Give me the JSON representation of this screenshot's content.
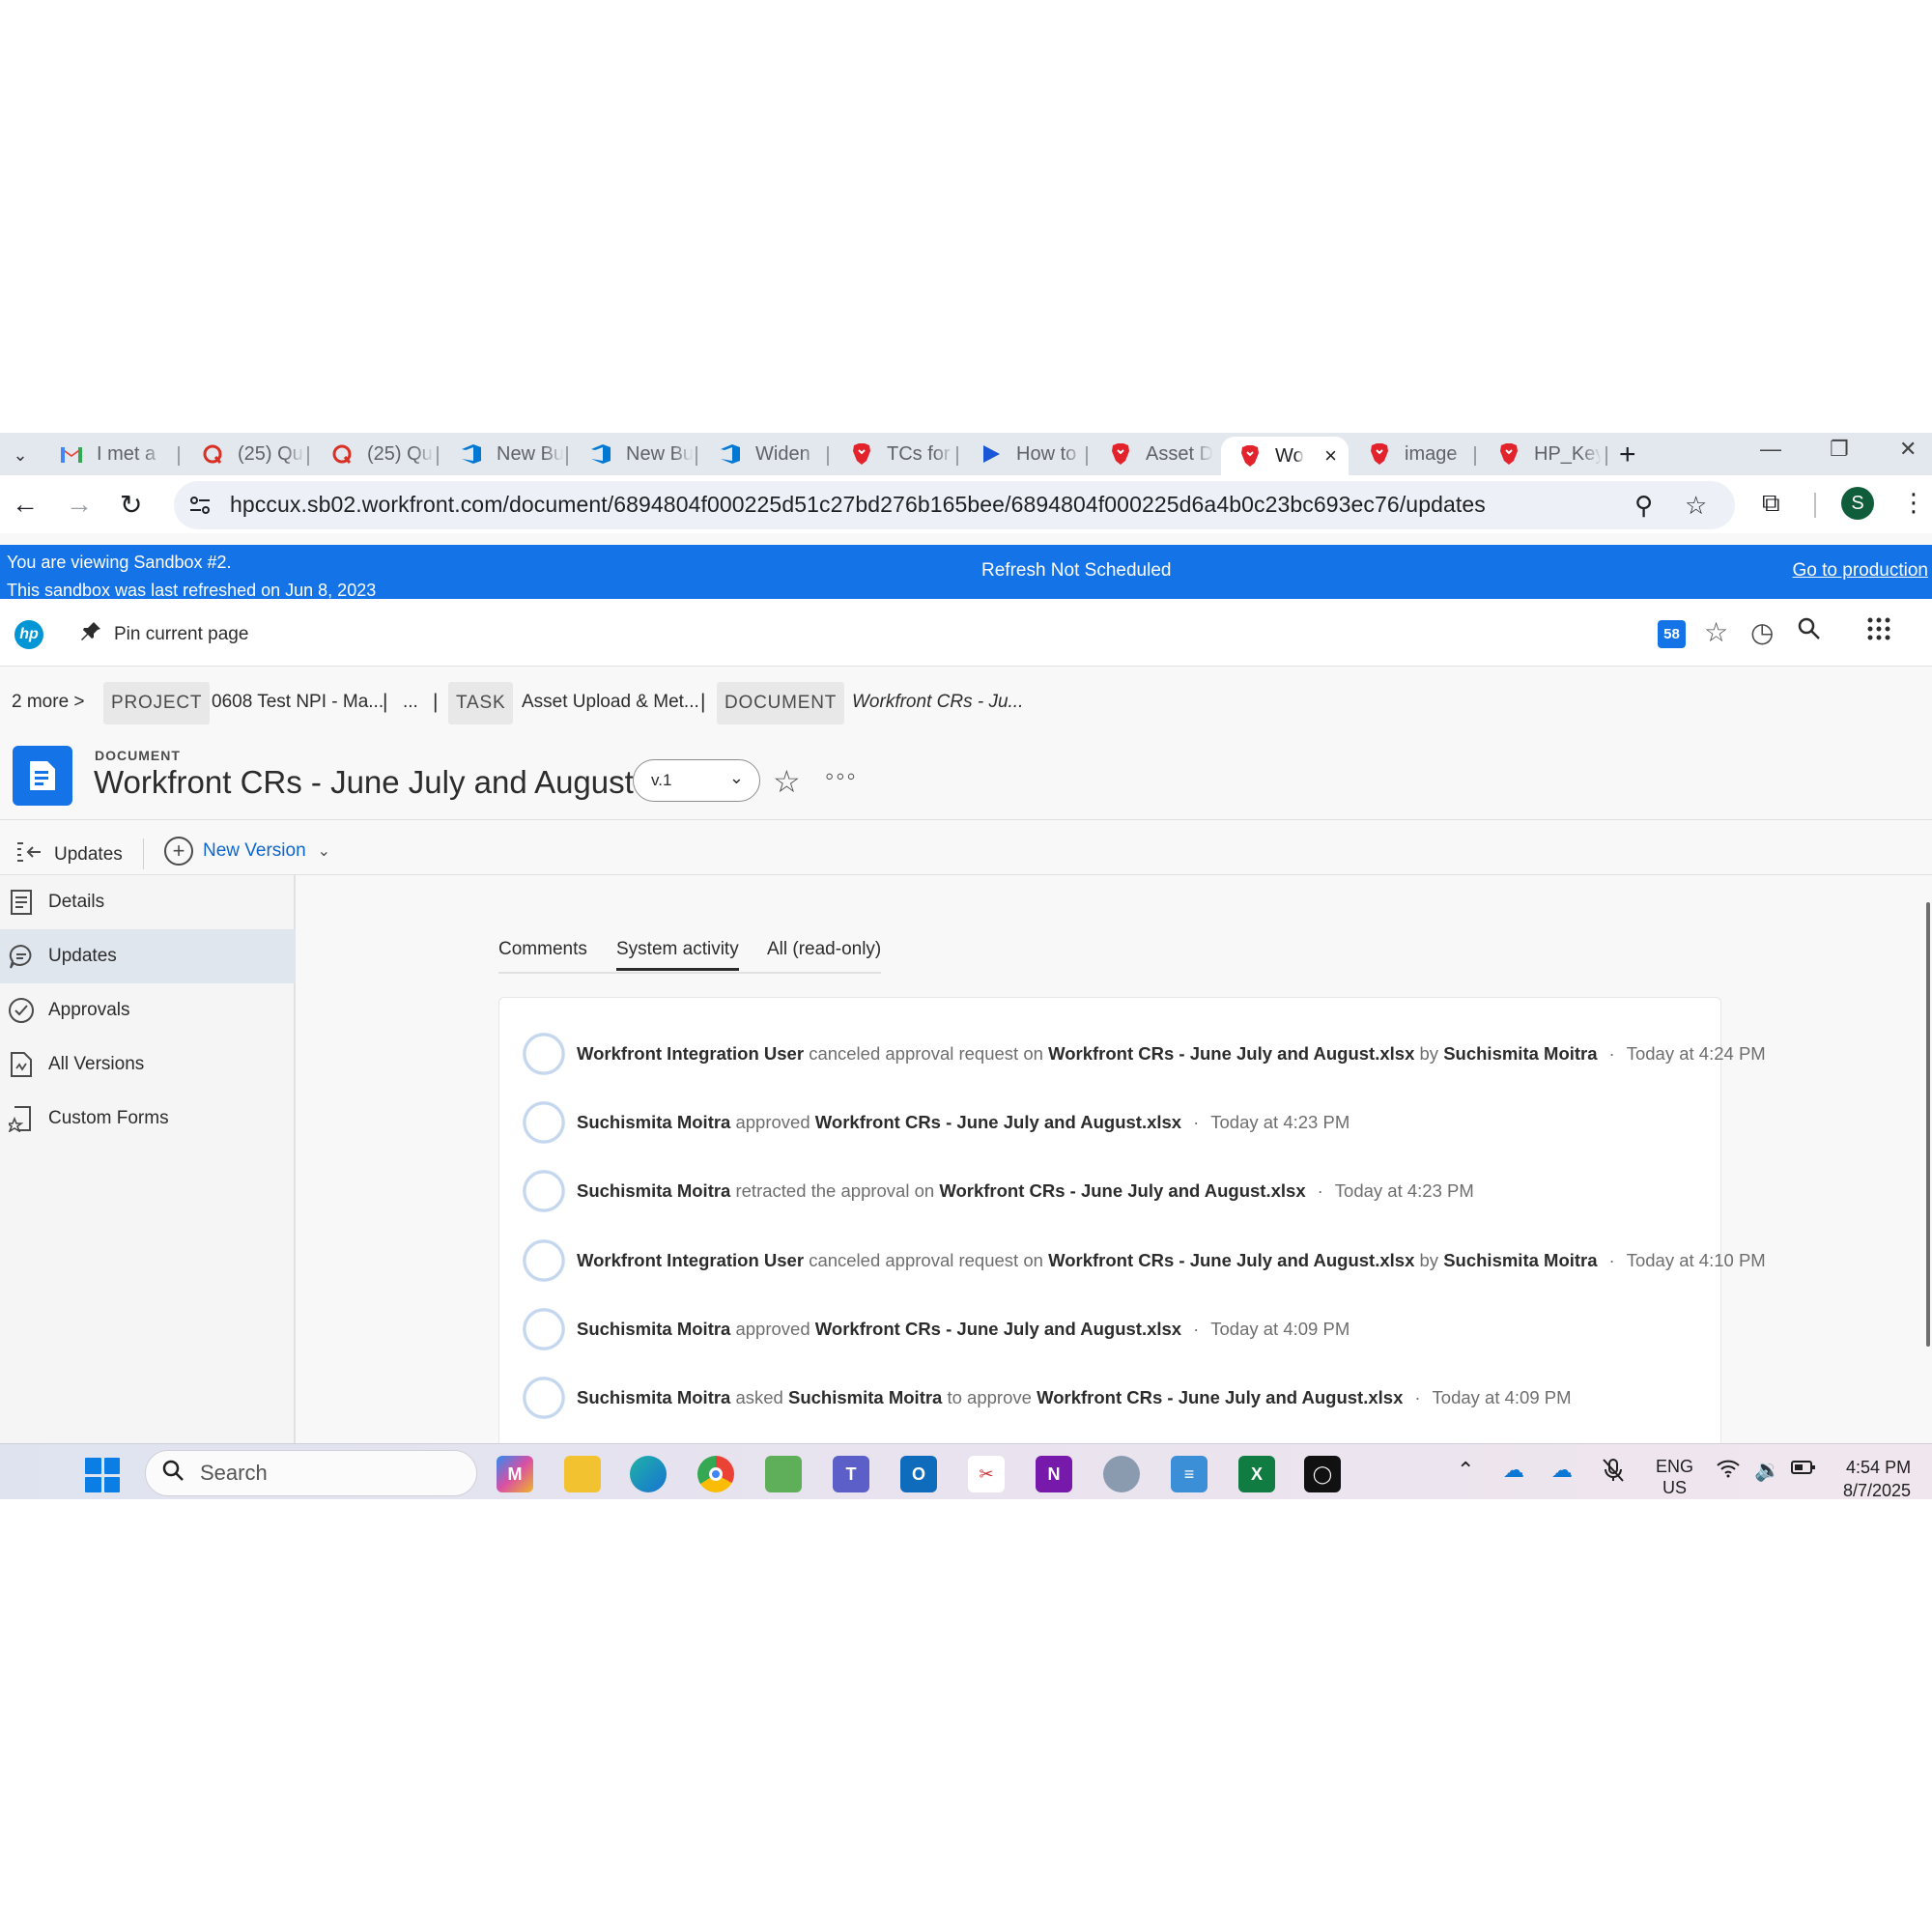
{
  "browser": {
    "tabs": [
      {
        "title": "I met a",
        "icon": "gmail-icon",
        "color": "#ea4335"
      },
      {
        "title": "(25) Qu",
        "icon": "quora-icon",
        "color": "#d93025"
      },
      {
        "title": "(25) Qu",
        "icon": "quora-icon",
        "color": "#d93025"
      },
      {
        "title": "New Bu",
        "icon": "azure-devops-icon",
        "color": "#0078d4"
      },
      {
        "title": "New Bu",
        "icon": "azure-devops-icon",
        "color": "#0078d4"
      },
      {
        "title": "Widen",
        "icon": "azure-devops-icon",
        "color": "#0078d4"
      },
      {
        "title": "TCs for",
        "icon": "brave-icon",
        "color": "#e3232b"
      },
      {
        "title": "How to",
        "icon": "play-icon",
        "color": "#1a57d6"
      },
      {
        "title": "Asset D",
        "icon": "brave-icon",
        "color": "#e3232b"
      },
      {
        "title": "Wo",
        "icon": "brave-icon",
        "color": "#e3232b",
        "active": true
      },
      {
        "title": "image",
        "icon": "brave-icon",
        "color": "#e3232b"
      },
      {
        "title": "HP_Key",
        "icon": "brave-icon",
        "color": "#e3232b"
      }
    ],
    "url": "hpccux.sb02.workfront.com/document/6894804f000225d51c27bd276b165bee/6894804f000225d6a4b0c23bc693ec76/updates",
    "profile_initial": "S"
  },
  "banner": {
    "line1": "You are viewing Sandbox #2.",
    "line2": "This sandbox was last refreshed on Jun 8, 2023",
    "center": "Refresh Not Scheduled",
    "right": "Go to production",
    "color": "#1473e6"
  },
  "app_header": {
    "logo": "hp",
    "pin_label": "Pin current page",
    "notification_count": "58"
  },
  "breadcrumb": {
    "more": "2 more",
    "project_type": "PROJECT",
    "project_name": "0608 Test NPI - Ma...",
    "ellipsis": "...",
    "task_type": "TASK",
    "task_name": "Asset Upload & Met...",
    "document_type": "DOCUMENT",
    "document_name": "Workfront CRs - Ju..."
  },
  "document": {
    "kind": "DOCUMENT",
    "title": "Workfront CRs - June July and August",
    "version": "v.1"
  },
  "subtoolbar": {
    "updates_label": "Updates",
    "new_version_label": "New Version"
  },
  "sidenav": {
    "items": [
      {
        "label": "Details",
        "icon": "document-lines-icon"
      },
      {
        "label": "Updates",
        "icon": "comment-icon",
        "active": true
      },
      {
        "label": "Approvals",
        "icon": "check-circle-icon"
      },
      {
        "label": "All Versions",
        "icon": "versions-icon"
      },
      {
        "label": "Custom Forms",
        "icon": "custom-form-icon"
      }
    ]
  },
  "content_tabs": {
    "comments": "Comments",
    "system_activity": "System activity",
    "all": "All (read-only)"
  },
  "activity": [
    {
      "actor": "Workfront Integration User",
      "verb": "canceled approval request on",
      "object": "Workfront CRs - June July and August.xlsx",
      "by_word": "by",
      "by": "Suchismita Moitra",
      "time": "Today at 4:24 PM"
    },
    {
      "actor": "Suchismita Moitra",
      "verb": "approved",
      "object": "Workfront CRs - June July and August.xlsx",
      "time": "Today at 4:23 PM"
    },
    {
      "actor": "Suchismita Moitra",
      "verb": "retracted the approval on",
      "object": "Workfront CRs - June July and August.xlsx",
      "time": "Today at 4:23 PM"
    },
    {
      "actor": "Workfront Integration User",
      "verb": "canceled approval request on",
      "object": "Workfront CRs - June July and August.xlsx",
      "by_word": "by",
      "by": "Suchismita Moitra",
      "time": "Today at 4:10 PM"
    },
    {
      "actor": "Suchismita Moitra",
      "verb": "approved",
      "object": "Workfront CRs - June July and August.xlsx",
      "time": "Today at 4:09 PM"
    },
    {
      "actor": "Suchismita Moitra",
      "verb": "asked",
      "target": "Suchismita Moitra",
      "verb2": "to approve",
      "object": "Workfront CRs - June July and August.xlsx",
      "time": "Today at 4:09 PM"
    }
  ],
  "taskbar": {
    "search_placeholder": "Search",
    "apps": [
      "m365-icon",
      "file-explorer-icon",
      "edge-icon",
      "chrome-icon",
      "photos-icon",
      "teams-icon",
      "outlook-icon",
      "snipping-tool-icon",
      "onenote-icon",
      "mouse-app-icon",
      "notepad-icon",
      "excel-icon",
      "auth-app-icon"
    ],
    "lang_line1": "ENG",
    "lang_line2": "US",
    "time": "4:54 PM",
    "date": "8/7/2025"
  }
}
